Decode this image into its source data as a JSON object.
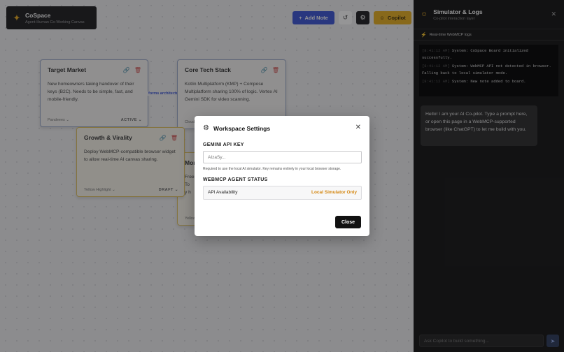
{
  "brand": {
    "name": "CoSpace",
    "tagline": "Agent-Human Co-Working Canvas"
  },
  "toolbar": {
    "add_note": "Add Note",
    "copilot": "Copilot"
  },
  "notes": [
    {
      "title": "Target Market",
      "body": "New homeowners taking handover of their keys (B2C). Needs to be simple, fast, and mobile-friendly.",
      "color": "Pandeees",
      "status": "ACTIVE"
    },
    {
      "title": "Core Tech Stack",
      "body": "Kotlin Multiplatform (KMP) + Compose Multiplatform sharing 100% of logic. Vertex AI Gemini SDK for video scanning.",
      "color": "Cloud",
      "status": ""
    },
    {
      "title": "Growth & Virality",
      "body": "Deploy WebMCP-compatible browser widget to allow real-time AI canvas sharing.",
      "color": "Yellow Highlight",
      "status": "DRAFT"
    },
    {
      "title": "Mon",
      "body": "Freem\nTo \ny h",
      "color": "Yellow",
      "status": ""
    }
  ],
  "connector_label": "forms architecture",
  "panel": {
    "title": "Simulator & Logs",
    "subtitle": "Co-pilot interaction layer",
    "logs_header": "Real-time WebMCP logs",
    "logs": [
      {
        "time": "[8:41:12 AM]",
        "text": "System: CoSpace Board initialized successfully."
      },
      {
        "time": "[8:41:12 AM]",
        "text": "System: WebMCP API not detected in browser. Falling back to local simulator mode."
      },
      {
        "time": "[8:41:12 AM]",
        "text": "System: New note added to board."
      }
    ],
    "assistant_message": "Hello! I am your AI Co-pilot. Type a prompt here, or open this page in a WebMCP-supported browser (like ChatGPT) to let me build with you.",
    "chat_placeholder": "Ask Copilot to build something..."
  },
  "modal": {
    "title": "Workspace Settings",
    "api_key_label": "GEMINI API KEY",
    "api_key_placeholder": "AIzaSy...",
    "api_key_help": "Required to use the local AI simulator. Key remains entirely in your local browser storage.",
    "status_label": "WEBMCP AGENT STATUS",
    "availability_label": "API Availability",
    "availability_value": "Local Simulator Only",
    "close_label": "Close"
  },
  "colors": {
    "accent": "#3b55d6",
    "copilot": "#e8b020",
    "warning": "#d4860f"
  }
}
